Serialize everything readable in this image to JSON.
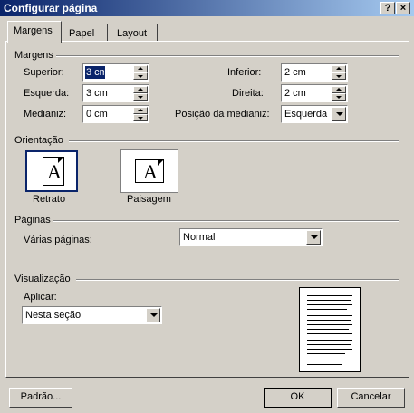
{
  "window": {
    "title": "Configurar página",
    "help_label": "?",
    "close_label": "×"
  },
  "tabs": [
    {
      "label": "Margens",
      "active": true
    },
    {
      "label": "Papel",
      "active": false
    },
    {
      "label": "Layout",
      "active": false
    }
  ],
  "margins": {
    "section_label": "Margens",
    "superior": {
      "label": "Superior:",
      "value": "3 cm"
    },
    "esquerda": {
      "label": "Esquerda:",
      "value": "3 cm"
    },
    "medianiz": {
      "label": "Medianiz:",
      "value": "0 cm"
    },
    "inferior": {
      "label": "Inferior:",
      "value": "2 cm"
    },
    "direita": {
      "label": "Direita:",
      "value": "2 cm"
    },
    "posicao_medianiz": {
      "label": "Posição da medianiz:",
      "value": "Esquerda"
    }
  },
  "orientation": {
    "section_label": "Orientação",
    "portrait": {
      "label": "Retrato",
      "icon_letter": "A",
      "selected": true
    },
    "landscape": {
      "label": "Paisagem",
      "icon_letter": "A",
      "selected": false
    }
  },
  "pages": {
    "section_label": "Páginas",
    "multiple_label": "Várias páginas:",
    "multiple_value": "Normal"
  },
  "preview": {
    "section_label": "Visualização",
    "apply_label": "Aplicar:",
    "apply_value": "Nesta seção"
  },
  "buttons": {
    "default_label": "Padrão...",
    "ok_label": "OK",
    "cancel_label": "Cancelar"
  },
  "colors": {
    "titlebar_start": "#0a246a",
    "titlebar_end": "#a6caf0",
    "dialog_bg": "#d4d0c8",
    "selection": "#0a246a"
  }
}
